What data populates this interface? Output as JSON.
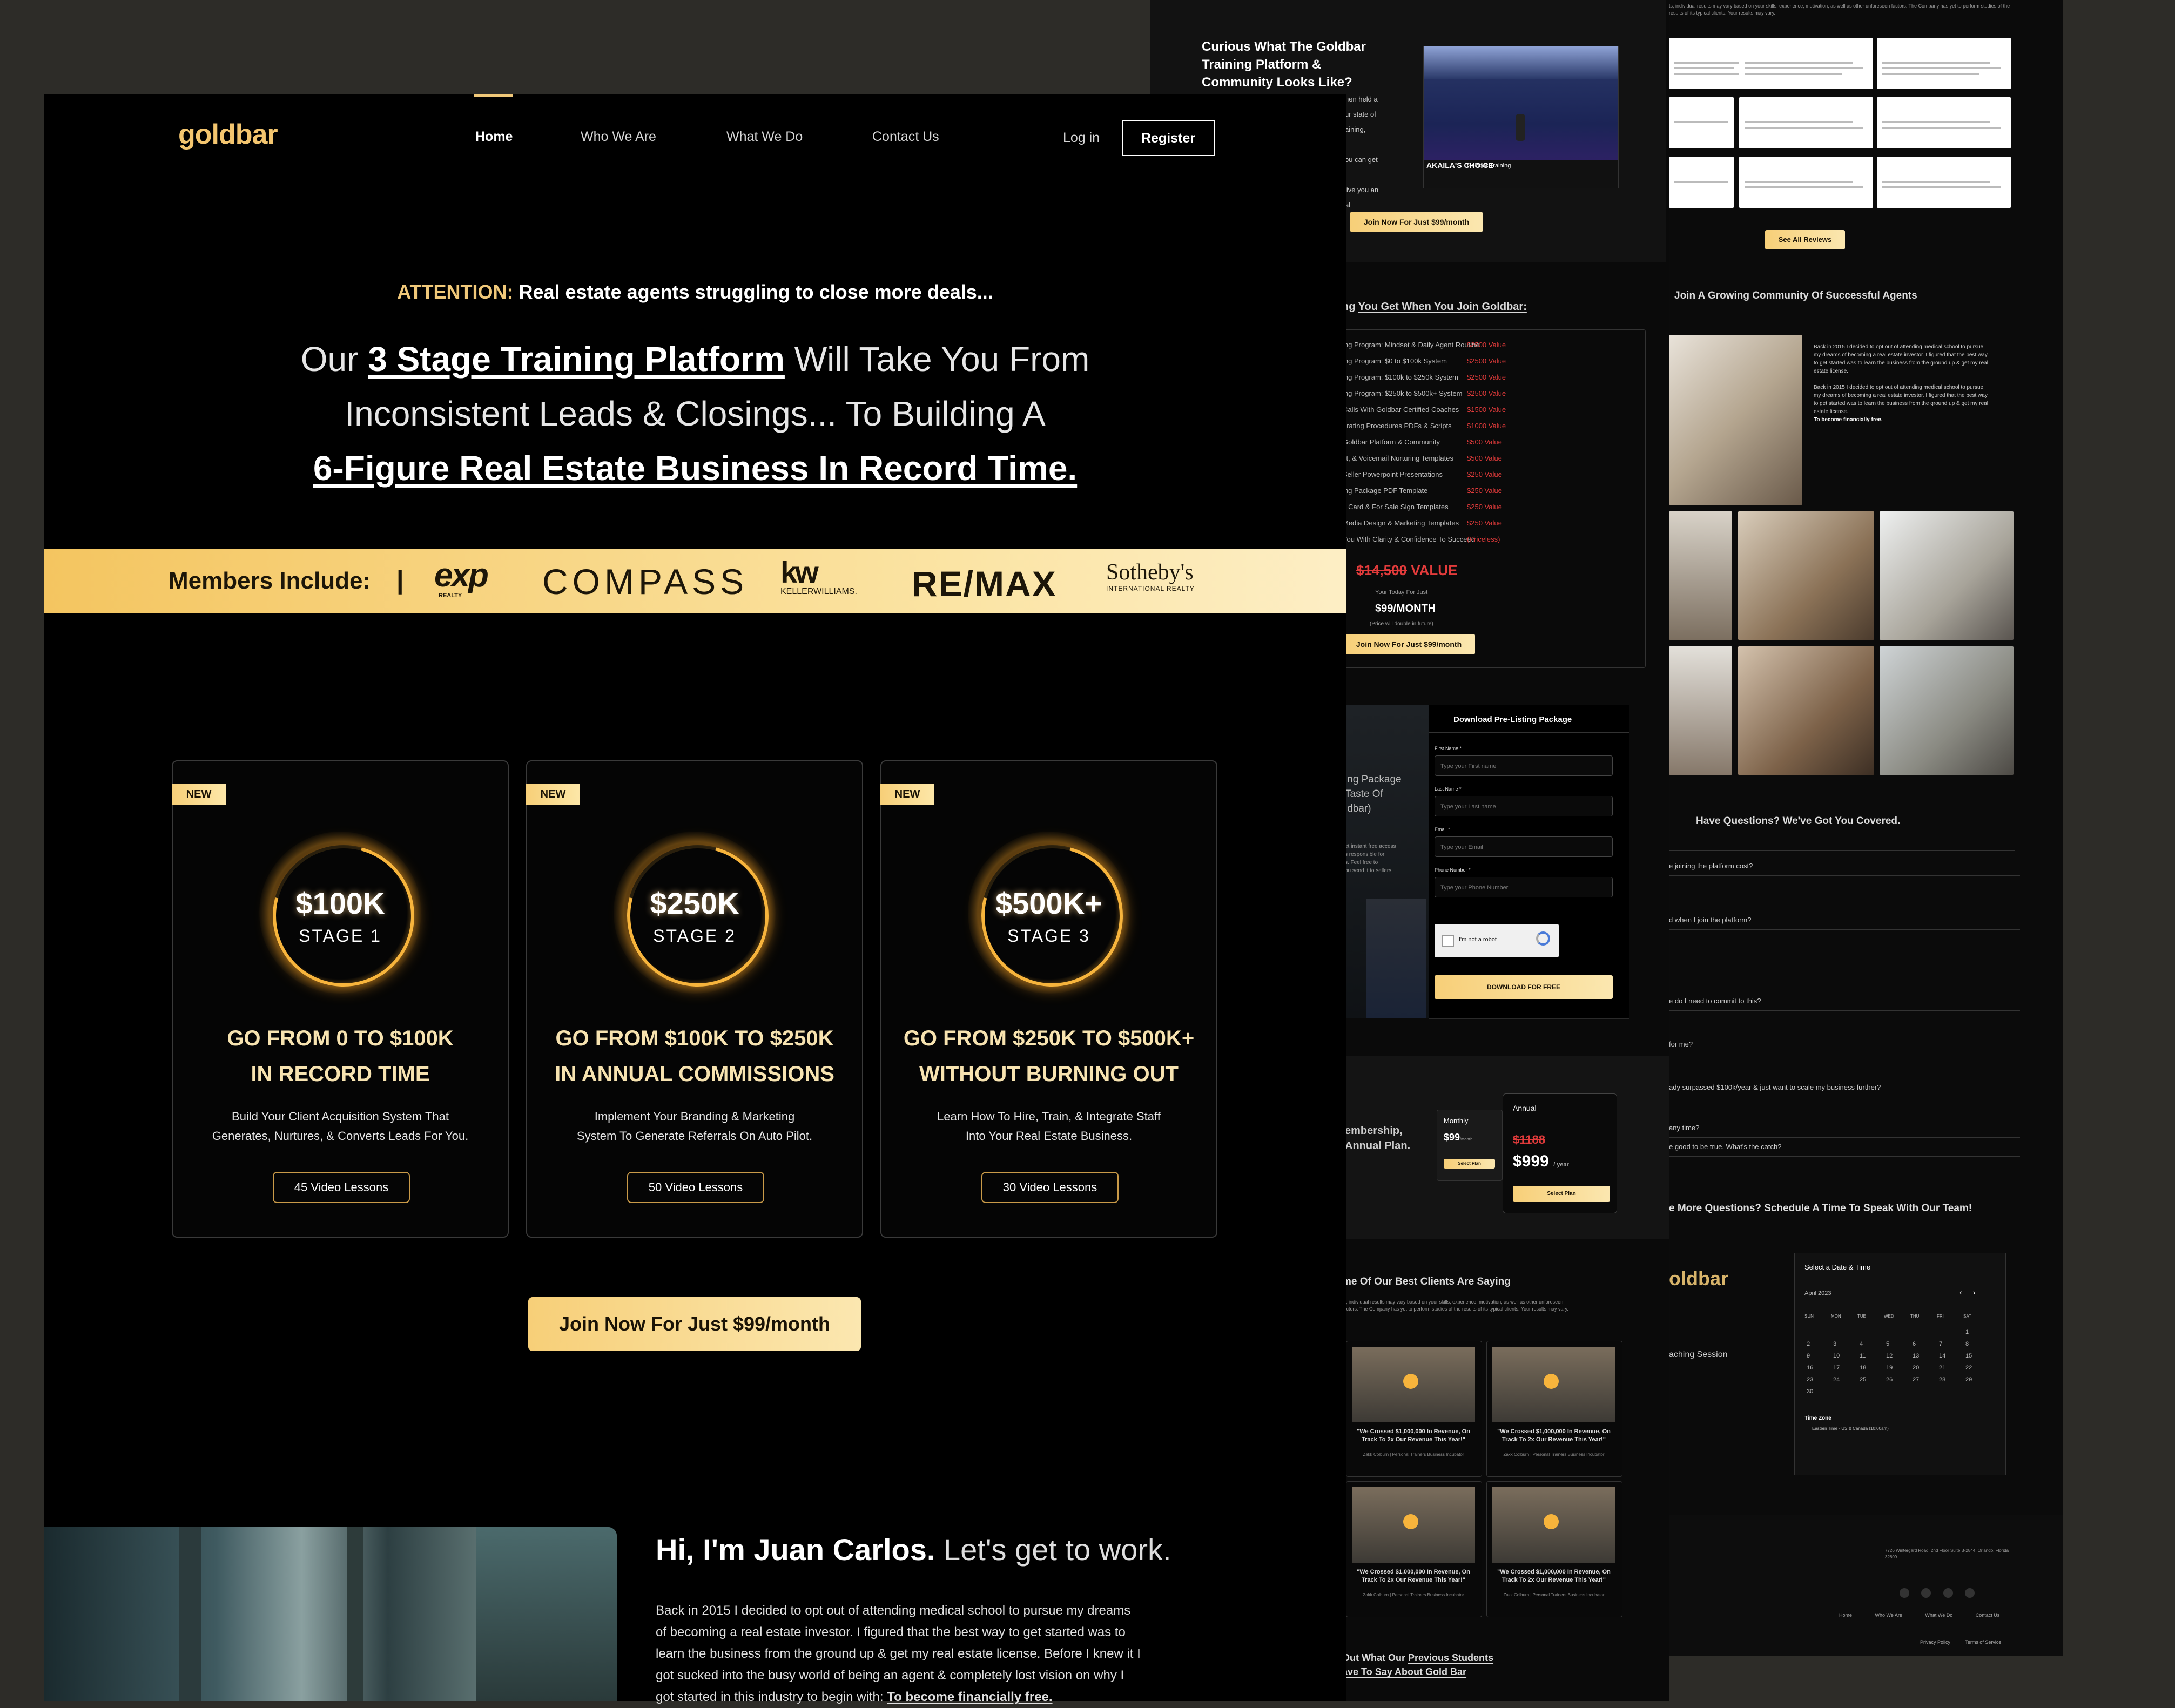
{
  "nav": {
    "logo": "goldbar",
    "links": [
      "Home",
      "Who We Are",
      "What We Do",
      "Contact Us"
    ],
    "login": "Log in",
    "register": "Register"
  },
  "hero": {
    "attention_label": "ATTENTION:",
    "attention_text": "Real estate agents struggling to close more deals...",
    "line1_pre": "Our ",
    "line1_link": "3 Stage Training Platform",
    "line1_post": " Will Take You From",
    "line2": "Inconsistent Leads & Closings... To Building A",
    "line3": "6-Figure Real Estate Business In Record Time."
  },
  "members": {
    "label": "Members Include:",
    "sep": "|",
    "logos": [
      "exp",
      "REALTY",
      "COMPASS",
      "kw",
      "KELLERWILLIAMS.",
      "RE/MAX",
      "Sotheby's",
      "INTERNATIONAL REALTY"
    ]
  },
  "stages": [
    {
      "badge": "NEW",
      "value": "$100K",
      "stage": "STAGE 1",
      "title1": "GO FROM 0 TO $100K",
      "title2": "IN RECORD TIME",
      "desc1": "Build Your Client Acquisition System That",
      "desc2": "Generates, Nurtures, & Converts Leads For You.",
      "button": "45 Video Lessons"
    },
    {
      "badge": "NEW",
      "value": "$250K",
      "stage": "STAGE 2",
      "title1": "GO FROM $100K TO $250K",
      "title2": "IN ANNUAL COMMISSIONS",
      "desc1": "Implement Your Branding & Marketing",
      "desc2": "System To Generate Referrals On Auto Pilot.",
      "button": "50 Video Lessons"
    },
    {
      "badge": "NEW",
      "value": "$500K+",
      "stage": "STAGE 3",
      "title1": "GO FROM $250K TO $500K+",
      "title2": "WITHOUT BURNING OUT",
      "desc1": "Learn How To Hire, Train, & Integrate Staff",
      "desc2": "Into Your Real Estate Business.",
      "button": "30 Video Lessons"
    }
  ],
  "cta": "Join Now For Just $99/month",
  "about": {
    "title_bold": "Hi, I'm Juan Carlos.",
    "title_rest": " Let's get to work.",
    "para": [
      "Back in 2015 I decided to opt out of attending medical school to pursue my dreams",
      "of becoming a real estate investor. I figured that the best way to get started was to",
      "learn the business from the ground up & get my real estate license. Before I knew it I",
      "got sucked into the busy world of being an agent & completely lost vision on why I"
    ],
    "para_last_pre": "got started in this industry to begin with: ",
    "para_last_bold": "To become financially free."
  },
  "right": {
    "curious_title": [
      "Curious What The Goldbar",
      "Training Platform &",
      "Community Looks Like?"
    ],
    "curious_body": [
      "hen held a",
      "ur state of",
      "aining,",
      "ou can get",
      "live you an",
      "al"
    ],
    "video_banner": "Goldbar Training",
    "award": "AKAILA'S CHOICE",
    "cta_small": "Join Now For Just $99/month",
    "see_reviews": "See All Reviews",
    "reviews_intro": "ts, individual results may vary based on your skills, experience, motivation, as well as other unforeseen factors. The Company has yet to perform studies of the results of its typical clients. Your results may vary.",
    "what_you_get_pre": "ng ",
    "what_you_get": "You Get When You Join Goldbar:",
    "value_items": [
      {
        "label": "ing Program: Mindset & Daily Agent Routine",
        "value": "$2500 Value"
      },
      {
        "label": "ing Program: $0 to $100k System",
        "value": "$2500 Value"
      },
      {
        "label": "ing Program: $100k to $250k System",
        "value": "$2500 Value"
      },
      {
        "label": "ing Program: $250k to $500k+ System",
        "value": "$2500 Value"
      },
      {
        "label": "Calls With Goldbar Certified Coaches",
        "value": "$1500 Value"
      },
      {
        "label": "erating Procedures PDFs & Scripts",
        "value": "$1000 Value"
      },
      {
        "label": "Goldbar Platform & Community",
        "value": "$500 Value"
      },
      {
        "label": "xt, & Voicemail Nurturing Templates",
        "value": "$500 Value"
      },
      {
        "label": "Seller Powerpoint Presentations",
        "value": "$250 Value"
      },
      {
        "label": "ing Package PDF Template",
        "value": "$250 Value"
      },
      {
        "label": "s Card & For Sale Sign Templates",
        "value": "$250 Value"
      },
      {
        "label": "Media Design & Marketing Templates",
        "value": "$250 Value"
      },
      {
        "label": "You With Clarity & Confidence To Succeed",
        "value": "(Priceless)"
      }
    ],
    "total_strike": "$14,500",
    "total_value": "VALUE",
    "yours_today": "Your Today For Just",
    "price": "$99/MONTH",
    "price_note": "(Price will double in future)",
    "community_pre": "Join A ",
    "community": "Growing Community Of Successful Agents",
    "community_body": [
      "Back in 2015 I decided to opt out of attending medical school to pursue",
      "my dreams of becoming a real estate investor. I figured that the best way",
      "to get started was to learn the business from the ground up & get my real",
      "estate license."
    ],
    "community_bold": "To become financially free.",
    "download_title": "Download Pre-Listing Package",
    "download_side": [
      "ing Package",
      "Taste Of",
      "ldbar)"
    ],
    "download_side_small": [
      "et instant free access",
      "s responsible for",
      "s. Feel free to",
      "ou send it to sellers"
    ],
    "fields": [
      {
        "label": "First Name *",
        "placeholder": "Type your First name"
      },
      {
        "label": "Last Name *",
        "placeholder": "Type your Last name"
      },
      {
        "label": "Email *",
        "placeholder": "Type your Email"
      },
      {
        "label": "Phone Number *",
        "placeholder": "Type your Phone Number"
      }
    ],
    "captcha": "I'm not a robot",
    "download_btn": "DOWNLOAD FOR FREE",
    "faq_title": "Have Questions? We've Got You Covered.",
    "faqs": [
      "e joining the platform cost?",
      "d when I join the platform?",
      "e do I need to commit to this?",
      "for me?",
      "ady surpassed $100k/year & just want to scale my business further?",
      "any time?",
      "e good to be true. What's the catch?"
    ],
    "plans_side": [
      "embership,",
      "Annual Plan."
    ],
    "monthly_label": "Monthly",
    "monthly_price": "$99",
    "monthly_unit": "/month",
    "annual_label": "Annual",
    "annual_strike": "$1188",
    "annual_price": "$999",
    "annual_unit": "/ year",
    "select_plan": "Select Plan",
    "schedule_title": "e More Questions? Schedule A Time To Speak With Our Team!",
    "schedule_logo": "oldbar",
    "schedule_session": "aching Session",
    "cal_title": "Select a Date & Time",
    "cal_month": "April 2023",
    "cal_days": [
      "SUN",
      "MON",
      "TUE",
      "WED",
      "THU",
      "FRI",
      "SAT"
    ],
    "cal_nums": [
      "1",
      "2",
      "3",
      "4",
      "5",
      "6",
      "7",
      "8",
      "9",
      "10",
      "11",
      "12",
      "13",
      "14",
      "15",
      "16",
      "17",
      "18",
      "19",
      "20",
      "21",
      "22",
      "23",
      "24",
      "25",
      "26",
      "27",
      "28",
      "29",
      "30"
    ],
    "time_zone": "Time Zone",
    "tz_value": "Eastern Time - US & Canada (10:00am)",
    "clients_pre": "me Of Our ",
    "clients": "Best Clients Are Saying",
    "video_caption": "\"We Crossed $1,000,000 In Revenue, On Track To 2x Our Revenue This Year!\"",
    "video_by": "Zakk Colburn | Personal Trainers Business Incubator",
    "students_pre": "Out What Our ",
    "students": "Previous Students",
    "students2": "ave To Say About Gold Bar",
    "footer_address": "7726 Wintergard Road, 2nd Floor Suite B-2844, Orlando, Florida 32809",
    "footer_links": [
      "Home",
      "Who We Are",
      "What We Do",
      "Contact Us"
    ],
    "privacy": "Privacy Policy",
    "terms": "Terms of Service"
  },
  "colors": {
    "gold": "#f7cf78",
    "gold_light": "#fbe7b0",
    "value_red": "#e23b3b",
    "bg": "#000000",
    "backdrop": "#2d2c28"
  }
}
